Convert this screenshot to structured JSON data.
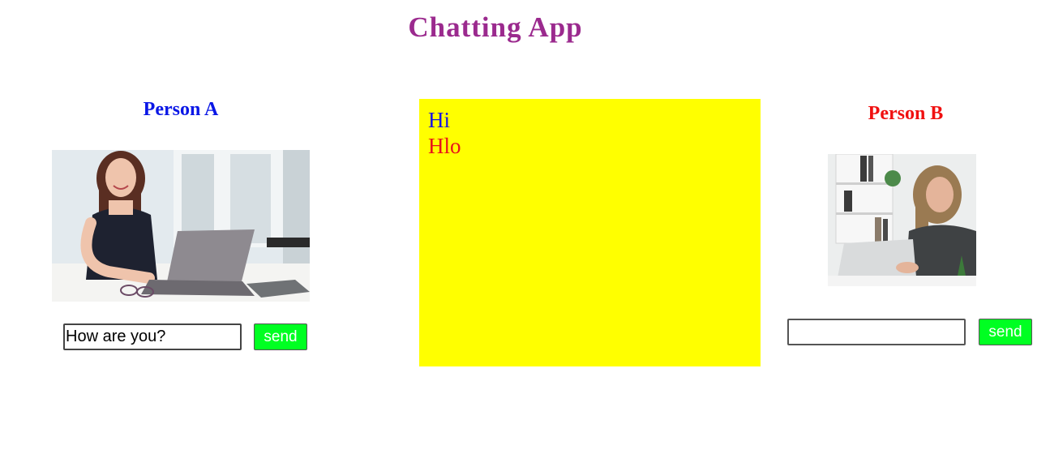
{
  "app": {
    "title": "Chatting App"
  },
  "person_a": {
    "name": "Person A",
    "name_color": "#0a17e6",
    "photo": "person-at-laptop-photo",
    "input_value": "How are you?",
    "send_label": "send"
  },
  "person_b": {
    "name": "Person B",
    "name_color": "#f01010",
    "photo": "person-at-laptop-photo",
    "input_value": "",
    "send_label": "send"
  },
  "chat": {
    "background": "#ffff00",
    "messages": [
      {
        "text": "Hi",
        "from": "Person A",
        "color": "#1a15e0"
      },
      {
        "text": "Hlo",
        "from": "Person B",
        "color": "#e8141b"
      }
    ]
  },
  "colors": {
    "title": "#9b2a8e",
    "send_button": "#00ff22",
    "send_text": "#ffffff"
  }
}
